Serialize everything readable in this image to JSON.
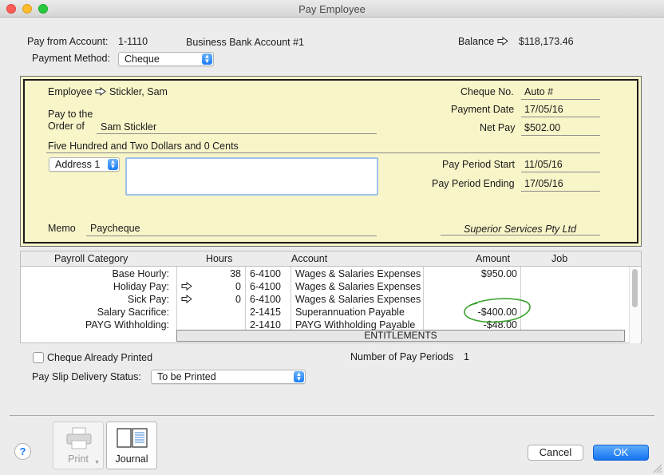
{
  "window": {
    "title": "Pay Employee"
  },
  "header": {
    "pay_from_label": "Pay from Account:",
    "account_number": "1-1110",
    "account_name": "Business Bank Account #1",
    "balance_label": "Balance",
    "balance_value": "$118,173.46",
    "payment_method_label": "Payment Method:",
    "payment_method_value": "Cheque"
  },
  "cheque": {
    "employee_label": "Employee",
    "employee_value": "Stickler, Sam",
    "pay_to_label_1": "Pay to the",
    "pay_to_label_2": "Order of",
    "pay_to_value": "Sam Stickler",
    "amount_words": "Five Hundred and Two Dollars and 0 Cents",
    "address_select": "Address 1",
    "memo_label": "Memo",
    "memo_value": "Paycheque",
    "cheque_no_label": "Cheque No.",
    "cheque_no_value": "Auto #",
    "payment_date_label": "Payment Date",
    "payment_date_value": "17/05/16",
    "net_pay_label": "Net Pay",
    "net_pay_value": "$502.00",
    "pay_period_start_label": "Pay Period Start",
    "pay_period_start_value": "11/05/16",
    "pay_period_ending_label": "Pay Period Ending",
    "pay_period_ending_value": "17/05/16",
    "company_name": "Superior Services Pty Ltd"
  },
  "table": {
    "columns": [
      "Payroll Category",
      "Hours",
      "Account",
      "Amount",
      "Job"
    ],
    "rows": [
      {
        "category": "Base Hourly:",
        "hours": "38",
        "acct_no": "6-4100",
        "acct_name": "Wages & Salaries Expenses",
        "amount": "$950.00"
      },
      {
        "category": "Holiday Pay:",
        "hours": "0",
        "acct_no": "6-4100",
        "acct_name": "Wages & Salaries Expenses",
        "amount": ""
      },
      {
        "category": "Sick Pay:",
        "hours": "0",
        "acct_no": "6-4100",
        "acct_name": "Wages & Salaries Expenses",
        "amount": ""
      },
      {
        "category": "Salary Sacrifice:",
        "hours": "",
        "acct_no": "2-1415",
        "acct_name": "Superannuation Payable",
        "amount": "-$400.00"
      },
      {
        "category": "PAYG Withholding:",
        "hours": "",
        "acct_no": "2-1410",
        "acct_name": "PAYG Withholding Payable",
        "amount": "-$48.00"
      }
    ],
    "entitlements_label": "ENTITLEMENTS"
  },
  "footer": {
    "cheque_printed_label": "Cheque Already Printed",
    "num_periods_label": "Number of Pay Periods",
    "num_periods_value": "1",
    "delivery_label": "Pay Slip Delivery Status:",
    "delivery_value": "To be Printed",
    "print_label": "Print",
    "journal_label": "Journal",
    "cancel_label": "Cancel",
    "ok_label": "OK",
    "help_label": "?"
  },
  "colors": {
    "cheque_bg": "#f8f5c9",
    "accent": "#1a7cf5",
    "annotation": "#3aa12c"
  }
}
